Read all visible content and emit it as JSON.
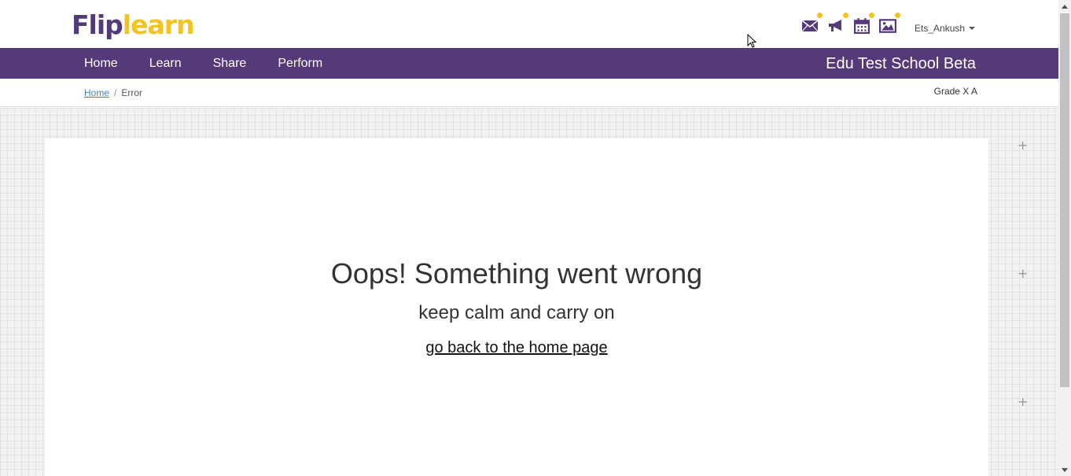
{
  "brand": {
    "part1": "Flip",
    "part2": "learn"
  },
  "header": {
    "icons": [
      "mail-icon",
      "megaphone-icon",
      "calendar-icon",
      "gallery-icon"
    ],
    "user_name": "Ets_Ankush"
  },
  "nav": {
    "items": [
      {
        "label": "Home"
      },
      {
        "label": "Learn"
      },
      {
        "label": "Share"
      },
      {
        "label": "Perform"
      }
    ],
    "school_name": "Edu Test School Beta"
  },
  "breadcrumb": {
    "home": "Home",
    "separator": "/",
    "current": "Error"
  },
  "grade": "Grade X A",
  "error": {
    "title": "Oops! Something went wrong",
    "subtitle": "keep calm and carry on",
    "link_text": "go back to the home page"
  },
  "colors": {
    "brand_purple": "#553a7a",
    "brand_yellow": "#f5c320",
    "link_blue": "#3a84c4"
  }
}
